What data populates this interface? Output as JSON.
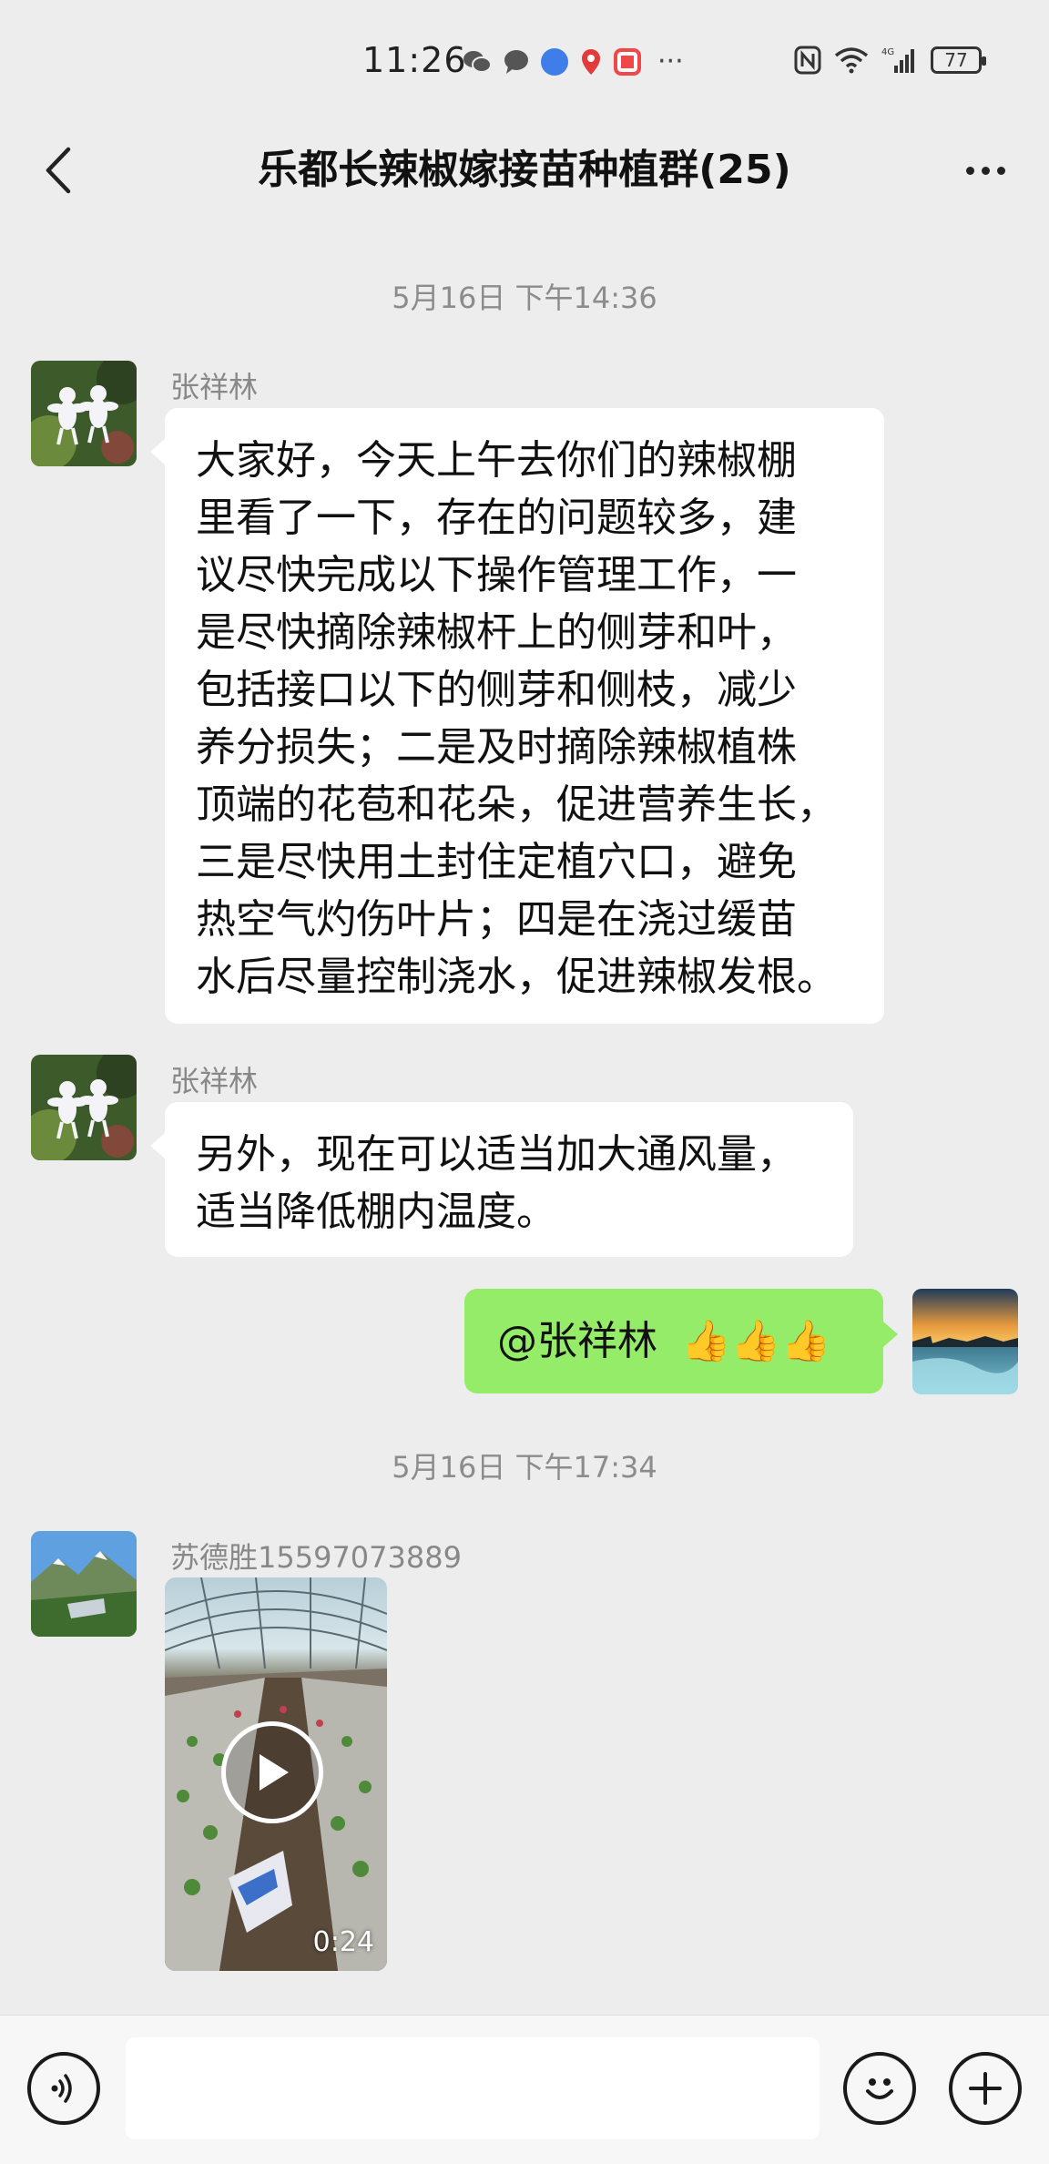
{
  "status_bar": {
    "time": "11:26",
    "more": "···",
    "battery": "77"
  },
  "header": {
    "title": "乐都长辣椒嫁接苗种植群(25)"
  },
  "messages": {
    "timestamp_1": "5月16日 下午14:36",
    "msg_1": {
      "sender": "张祥林",
      "lines": [
        "大家好，今天上午去你们的辣椒棚",
        "里看了一下，存在的问题较多，建",
        "议尽快完成以下操作管理工作，一",
        "是尽快摘除辣椒杆上的侧芽和叶，",
        "包括接口以下的侧芽和侧枝，减少",
        "养分损失；二是及时摘除辣椒植株",
        "顶端的花苞和花朵，促进营养生长，",
        "三是尽快用土封住定植穴口，避免",
        "热空气灼伤叶片；四是在浇过缓苗",
        "水后尽量控制浇水，促进辣椒发根。"
      ]
    },
    "msg_2": {
      "sender": "张祥林",
      "lines": [
        "另外，现在可以适当加大通风量，",
        "适当降低棚内温度。"
      ]
    },
    "msg_3": {
      "mention": "@张祥林",
      "emoji": "👍👍👍"
    },
    "timestamp_2": "5月16日 下午17:34",
    "msg_4": {
      "sender": "苏德胜15597073889",
      "video_duration": "0:24"
    }
  },
  "input_bar": {
    "text_value": ""
  },
  "colors": {
    "background": "#ededed",
    "my_bubble": "#95ec69",
    "other_bubble": "#ffffff"
  }
}
